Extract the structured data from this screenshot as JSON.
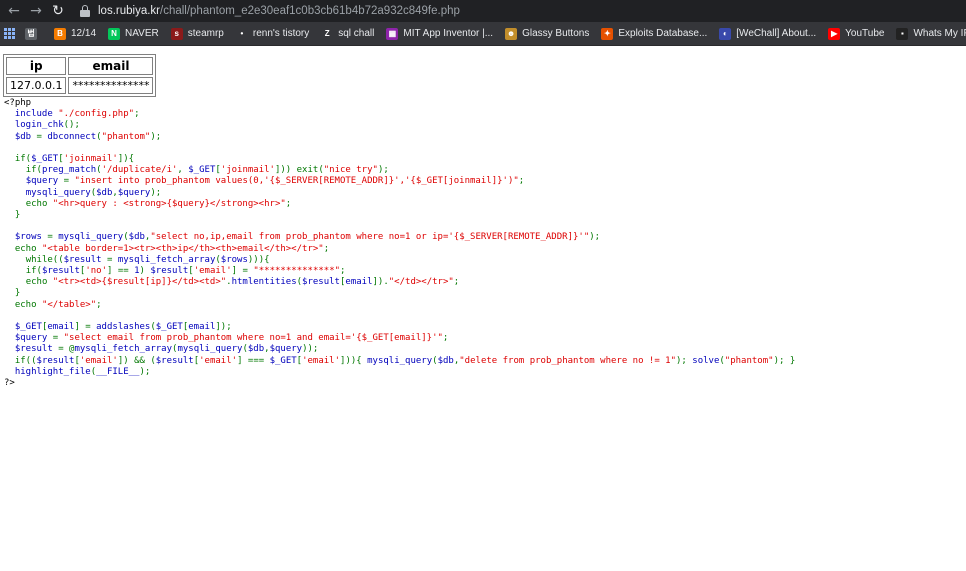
{
  "browser": {
    "back_glyph": "←",
    "forward_glyph": "→",
    "reload_glyph": "↻",
    "url_host": "los.rubiya.kr",
    "url_path": "/chall/phantom_e2e30eaf1c0b3cb61b4b72a932c849fe.php"
  },
  "bookmarks": [
    {
      "label": "",
      "icon": "korean-bookmark-icon",
      "icon_text": "법",
      "color": "#5f6368"
    },
    {
      "label": "12/14",
      "icon": "blogger-icon",
      "icon_text": "B",
      "color": "#f57c00"
    },
    {
      "label": "NAVER",
      "icon": "naver-icon",
      "icon_text": "N",
      "color": "#03c75a"
    },
    {
      "label": "steamrp",
      "icon": "steam-icon",
      "icon_text": "s",
      "color": "#8b1a1a"
    },
    {
      "label": "renn's tistory",
      "icon": "tistory-icon",
      "icon_text": "•",
      "color": "#35363a"
    },
    {
      "label": "sql chall",
      "icon": "z-icon",
      "icon_text": "Z",
      "color": "#35363a"
    },
    {
      "label": "MIT App Inventor |...",
      "icon": "app-inventor-icon",
      "icon_text": "▦",
      "color": "#8e24aa"
    },
    {
      "label": "Glassy Buttons",
      "icon": "glassy-icon",
      "icon_text": "☻",
      "color": "#c28e2b"
    },
    {
      "label": "Exploits Database...",
      "icon": "exploit-db-icon",
      "icon_text": "✦",
      "color": "#e65100"
    },
    {
      "label": "[WeChall] About...",
      "icon": "wechall-icon",
      "icon_text": "◐",
      "color": "#3949ab"
    },
    {
      "label": "YouTube",
      "icon": "youtube-icon",
      "icon_text": "▶",
      "color": "#ff0000"
    },
    {
      "label": "Whats My IP Addr...",
      "icon": "whatsmyip-icon",
      "icon_text": "▪",
      "color": "#222222"
    }
  ],
  "result_table": {
    "headers": [
      "ip",
      "email"
    ],
    "row": [
      "127.0.0.1",
      "**************"
    ]
  },
  "code_lines": [
    [
      [
        "d",
        "<?php"
      ]
    ],
    [
      [
        "d",
        "  "
      ],
      [
        "v",
        "include "
      ],
      [
        "s",
        "\"./config.php\""
      ],
      [
        "k",
        ";"
      ]
    ],
    [
      [
        "d",
        "  "
      ],
      [
        "v",
        "login_chk"
      ],
      [
        "k",
        "();"
      ]
    ],
    [
      [
        "d",
        "  "
      ],
      [
        "v",
        "$db "
      ],
      [
        "k",
        "= "
      ],
      [
        "v",
        "dbconnect"
      ],
      [
        "k",
        "("
      ],
      [
        "s",
        "\"phantom\""
      ],
      [
        "k",
        ");"
      ]
    ],
    [
      [
        "d",
        ""
      ]
    ],
    [
      [
        "d",
        "  "
      ],
      [
        "k",
        "if("
      ],
      [
        "v",
        "$_GET"
      ],
      [
        "k",
        "["
      ],
      [
        "s",
        "'joinmail'"
      ],
      [
        "k",
        "]){"
      ]
    ],
    [
      [
        "d",
        "    "
      ],
      [
        "k",
        "if("
      ],
      [
        "v",
        "preg_match"
      ],
      [
        "k",
        "("
      ],
      [
        "s",
        "'/duplicate/i'"
      ],
      [
        "k",
        ", "
      ],
      [
        "v",
        "$_GET"
      ],
      [
        "k",
        "["
      ],
      [
        "s",
        "'joinmail'"
      ],
      [
        "k",
        "])) exit("
      ],
      [
        "s",
        "\"nice try\""
      ],
      [
        "k",
        ");"
      ]
    ],
    [
      [
        "d",
        "    "
      ],
      [
        "v",
        "$query "
      ],
      [
        "k",
        "= "
      ],
      [
        "s",
        "\"insert into prob_phantom values(0,'{$_SERVER[REMOTE_ADDR]}','{$_GET[joinmail]}')\""
      ],
      [
        "k",
        ";"
      ]
    ],
    [
      [
        "d",
        "    "
      ],
      [
        "v",
        "mysqli_query"
      ],
      [
        "k",
        "("
      ],
      [
        "v",
        "$db"
      ],
      [
        "k",
        ","
      ],
      [
        "v",
        "$query"
      ],
      [
        "k",
        ");"
      ]
    ],
    [
      [
        "d",
        "    "
      ],
      [
        "k",
        "echo "
      ],
      [
        "s",
        "\"<hr>query : <strong>{$query}</strong><hr>\""
      ],
      [
        "k",
        ";"
      ]
    ],
    [
      [
        "d",
        "  "
      ],
      [
        "k",
        "}"
      ]
    ],
    [
      [
        "d",
        ""
      ]
    ],
    [
      [
        "d",
        "  "
      ],
      [
        "v",
        "$rows "
      ],
      [
        "k",
        "= "
      ],
      [
        "v",
        "mysqli_query"
      ],
      [
        "k",
        "("
      ],
      [
        "v",
        "$db"
      ],
      [
        "k",
        ","
      ],
      [
        "s",
        "\"select no,ip,email from prob_phantom where no=1 or ip='{$_SERVER[REMOTE_ADDR]}'\""
      ],
      [
        "k",
        ");"
      ]
    ],
    [
      [
        "d",
        "  "
      ],
      [
        "k",
        "echo "
      ],
      [
        "s",
        "\"<table border=1><tr><th>ip</th><th>email</th></tr>\""
      ],
      [
        "k",
        ";"
      ]
    ],
    [
      [
        "d",
        "    "
      ],
      [
        "k",
        "while(("
      ],
      [
        "v",
        "$result "
      ],
      [
        "k",
        "= "
      ],
      [
        "v",
        "mysqli_fetch_array"
      ],
      [
        "k",
        "("
      ],
      [
        "v",
        "$rows"
      ],
      [
        "k",
        "))){"
      ]
    ],
    [
      [
        "d",
        "    "
      ],
      [
        "k",
        "if("
      ],
      [
        "v",
        "$result"
      ],
      [
        "k",
        "["
      ],
      [
        "s",
        "'no'"
      ],
      [
        "k",
        "] == "
      ],
      [
        "v",
        "1"
      ],
      [
        "k",
        ") "
      ],
      [
        "v",
        "$result"
      ],
      [
        "k",
        "["
      ],
      [
        "s",
        "'email'"
      ],
      [
        "k",
        "] = "
      ],
      [
        "s",
        "\"**************\""
      ],
      [
        "k",
        ";"
      ]
    ],
    [
      [
        "d",
        "    "
      ],
      [
        "k",
        "echo "
      ],
      [
        "s",
        "\"<tr><td>{$result[ip]}</td><td>\""
      ],
      [
        "k",
        "."
      ],
      [
        "v",
        "htmlentities"
      ],
      [
        "k",
        "("
      ],
      [
        "v",
        "$result"
      ],
      [
        "k",
        "["
      ],
      [
        "v",
        "email"
      ],
      [
        "k",
        "])."
      ],
      [
        "s",
        "\"</td></tr>\""
      ],
      [
        "k",
        ";"
      ]
    ],
    [
      [
        "d",
        "  "
      ],
      [
        "k",
        "}"
      ]
    ],
    [
      [
        "d",
        "  "
      ],
      [
        "k",
        "echo "
      ],
      [
        "s",
        "\"</table>\""
      ],
      [
        "k",
        ";"
      ]
    ],
    [
      [
        "d",
        ""
      ]
    ],
    [
      [
        "d",
        "  "
      ],
      [
        "v",
        "$_GET"
      ],
      [
        "k",
        "["
      ],
      [
        "v",
        "email"
      ],
      [
        "k",
        "] = "
      ],
      [
        "v",
        "addslashes"
      ],
      [
        "k",
        "("
      ],
      [
        "v",
        "$_GET"
      ],
      [
        "k",
        "["
      ],
      [
        "v",
        "email"
      ],
      [
        "k",
        "]);"
      ]
    ],
    [
      [
        "d",
        "  "
      ],
      [
        "v",
        "$query "
      ],
      [
        "k",
        "= "
      ],
      [
        "s",
        "\"select email from prob_phantom where no=1 and email='{$_GET[email]}'\""
      ],
      [
        "k",
        ";"
      ]
    ],
    [
      [
        "d",
        "  "
      ],
      [
        "v",
        "$result "
      ],
      [
        "k",
        "= @"
      ],
      [
        "v",
        "mysqli_fetch_array"
      ],
      [
        "k",
        "("
      ],
      [
        "v",
        "mysqli_query"
      ],
      [
        "k",
        "("
      ],
      [
        "v",
        "$db"
      ],
      [
        "k",
        ","
      ],
      [
        "v",
        "$query"
      ],
      [
        "k",
        "));"
      ]
    ],
    [
      [
        "d",
        "  "
      ],
      [
        "k",
        "if(("
      ],
      [
        "v",
        "$result"
      ],
      [
        "k",
        "["
      ],
      [
        "s",
        "'email'"
      ],
      [
        "k",
        "]) && ("
      ],
      [
        "v",
        "$result"
      ],
      [
        "k",
        "["
      ],
      [
        "s",
        "'email'"
      ],
      [
        "k",
        "] === "
      ],
      [
        "v",
        "$_GET"
      ],
      [
        "k",
        "["
      ],
      [
        "s",
        "'email'"
      ],
      [
        "k",
        "])){ "
      ],
      [
        "v",
        "mysqli_query"
      ],
      [
        "k",
        "("
      ],
      [
        "v",
        "$db"
      ],
      [
        "k",
        ","
      ],
      [
        "s",
        "\"delete from prob_phantom where no != 1\""
      ],
      [
        "k",
        "); "
      ],
      [
        "v",
        "solve"
      ],
      [
        "k",
        "("
      ],
      [
        "s",
        "\"phantom\""
      ],
      [
        "k",
        "); }"
      ]
    ],
    [
      [
        "d",
        "  "
      ],
      [
        "v",
        "highlight_file"
      ],
      [
        "k",
        "("
      ],
      [
        "v",
        "__FILE__"
      ],
      [
        "k",
        ");"
      ]
    ],
    [
      [
        "d",
        "?>"
      ]
    ]
  ]
}
